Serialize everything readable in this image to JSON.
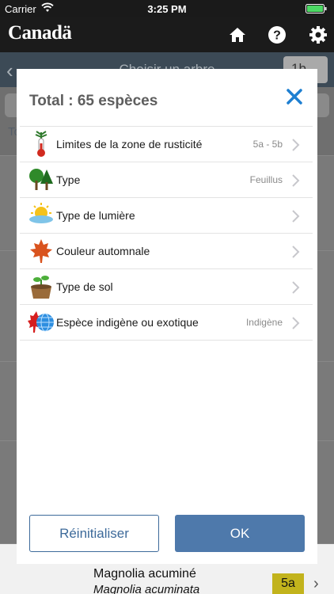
{
  "status_bar": {
    "carrier": "Carrier",
    "time": "3:25 PM"
  },
  "navbar": {
    "logo": "Canadä",
    "icons": [
      "home-icon",
      "help-icon",
      "gear-icon"
    ]
  },
  "background": {
    "title": "Choisir un arbre",
    "count": "1b",
    "tab_letter": "To",
    "visible_item": {
      "name": "Magnolia acuminé",
      "latin": "Magnolia acuminata",
      "zone": "5a"
    }
  },
  "modal": {
    "title": "Total : 65 espèces",
    "filters": [
      {
        "icon": "thermometer-tree-icon",
        "label": "Limites de la zone de rusticité",
        "value": "5a - 5b"
      },
      {
        "icon": "trees-icon",
        "label": "Type",
        "value": "Feuillus"
      },
      {
        "icon": "sun-cloud-icon",
        "label": "Type de lumière",
        "value": ""
      },
      {
        "icon": "maple-leaf-icon",
        "label": "Couleur automnale",
        "value": ""
      },
      {
        "icon": "sprout-soil-icon",
        "label": "Type de sol",
        "value": ""
      },
      {
        "icon": "leaf-globe-icon",
        "label": "Espèce indigène ou exotique",
        "value": "Indigène"
      }
    ],
    "reset_label": "Réinitialiser",
    "ok_label": "OK"
  },
  "colors": {
    "accent": "#4e79ab",
    "close": "#1e7fd1",
    "navbar": "#1b1b1b"
  }
}
